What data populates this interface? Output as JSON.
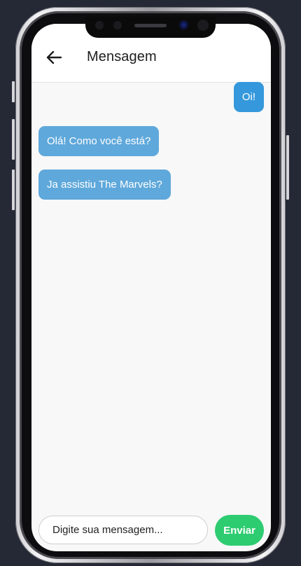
{
  "header": {
    "back_icon": "arrow-left-icon",
    "title": "Mensagem"
  },
  "messages": [
    {
      "text": "Oi!",
      "direction": "sent"
    },
    {
      "text": "Olá! Como você está?",
      "direction": "received"
    },
    {
      "text": "Ja assistiu The Marvels?",
      "direction": "received"
    }
  ],
  "composer": {
    "placeholder": "Digite sua mensagem...",
    "value": "",
    "send_label": "Enviar"
  },
  "colors": {
    "sent_bubble": "#3598dc",
    "received_bubble": "#5fa8db",
    "send_button": "#2ecc71",
    "background": "#252835"
  }
}
